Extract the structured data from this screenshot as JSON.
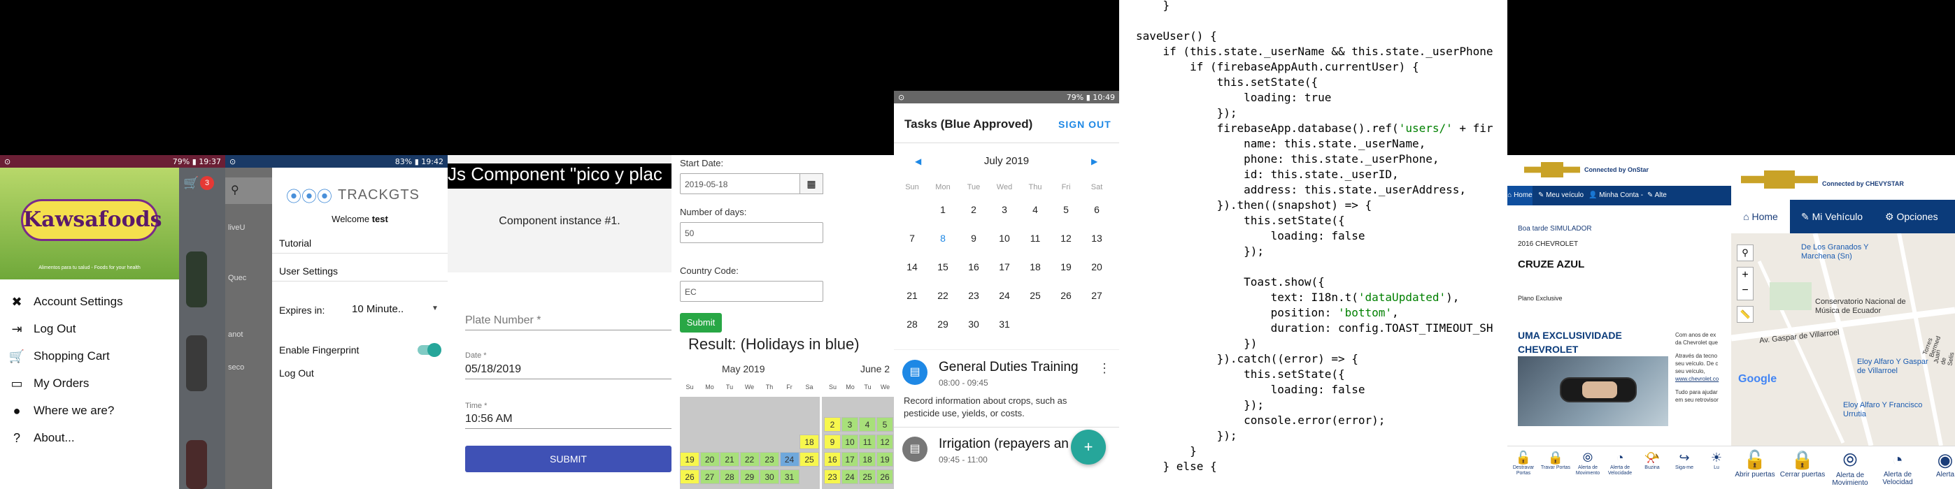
{
  "kawsa": {
    "time": "79% ▮ 19:37",
    "logo_text": "Kawsafoods",
    "logo_tagline": "Alimentos para tu salud - Foods for your health",
    "cart_count": "3",
    "menu": [
      {
        "icon": "✖",
        "label": "Account Settings"
      },
      {
        "icon": "⇥",
        "label": "Log Out"
      },
      {
        "icon": "🛒",
        "label": "Shopping Cart"
      },
      {
        "icon": "▭",
        "label": "My Orders"
      },
      {
        "icon": "●",
        "label": "Where we are?"
      },
      {
        "icon": "?",
        "label": "About..."
      }
    ]
  },
  "trackgts": {
    "time": "83% ▮ 19:42",
    "brand": "TRACKGTS",
    "welcome_prefix": "Welcome ",
    "welcome_user": "test",
    "tutorial": "Tutorial",
    "user_settings": "User Settings",
    "expires_label": "Expires in:",
    "expires_value": "10 Minute..",
    "fingerprint_label": "Enable Fingerprint",
    "logout": "Log Out",
    "bg_items": [
      "liveU",
      "Quec",
      "anot",
      "seco"
    ]
  },
  "vue": {
    "title": "Js Component \"pico y plac",
    "instance": "Component instance #1.",
    "plate_placeholder": "Plate Number *",
    "date_label": "Date *",
    "date_value": "05/18/2019",
    "time_label": "Time *",
    "time_value": "10:56 AM",
    "submit": "SUBMIT"
  },
  "holidays": {
    "start_label": "Start Date:",
    "start_value": "2019-05-18",
    "days_label": "Number of days:",
    "days_value": "50",
    "country_label": "Country Code:",
    "country_value": "EC",
    "submit": "Submit",
    "result": "Result: (Holidays in blue)",
    "month1": "May 2019",
    "month2": "June 2",
    "weekdays": [
      "Su",
      "Mo",
      "Tu",
      "We",
      "Th",
      "Fr",
      "Sa"
    ],
    "may_rows": [
      [
        "",
        "",
        "",
        "",
        "",
        "",
        ""
      ],
      [
        "",
        "",
        "",
        "",
        "",
        "",
        ""
      ],
      [
        "",
        "",
        "",
        "",
        "",
        "",
        "18"
      ],
      [
        "19",
        "20",
        "21",
        "22",
        "23",
        "24",
        "25"
      ],
      [
        "26",
        "27",
        "28",
        "29",
        "30",
        "31",
        ""
      ]
    ],
    "june_rows": [
      [
        "2",
        "3",
        "4",
        "5"
      ],
      [
        "9",
        "10",
        "11",
        "12"
      ],
      [
        "16",
        "17",
        "18",
        "19"
      ],
      [
        "23",
        "24",
        "25",
        "26"
      ]
    ]
  },
  "tasks": {
    "time": "79% ▮ 10:49",
    "title": "Tasks (Blue Approved)",
    "sign_out": "SIGN OUT",
    "month": "July 2019",
    "weekdays": [
      "Sun",
      "Mon",
      "Tue",
      "Wed",
      "Thu",
      "Fri",
      "Sat"
    ],
    "weeks": [
      [
        "",
        "1",
        "2",
        "3",
        "4",
        "5",
        "6"
      ],
      [
        "7",
        "8",
        "9",
        "10",
        "11",
        "12",
        "13"
      ],
      [
        "14",
        "15",
        "16",
        "17",
        "18",
        "19",
        "20"
      ],
      [
        "21",
        "22",
        "23",
        "24",
        "25",
        "26",
        "27"
      ],
      [
        "28",
        "29",
        "30",
        "31",
        "",
        "",
        ""
      ]
    ],
    "task1_title": "General Duties Training",
    "task1_time": "08:00 - 09:45",
    "task1_desc": "Record information about crops, such as pesticide use, yields, or costs.",
    "task2_title": "Irrigation (repayers an",
    "task2_time": "09:45 - 11:00",
    "fab": "+"
  },
  "code": {
    "lines": [
      "    }",
      "",
      "saveUser() {",
      "    if (this.state._userName && this.state._userPhone",
      "        if (firebaseAppAuth.currentUser) {",
      "            this.setState({",
      "                loading: true",
      "            });",
      "            firebaseApp.database().ref('users/' + fir",
      "                name: this.state._userName,",
      "                phone: this.state._userPhone,",
      "                id: this.state._userID,",
      "                address: this.state._userAddress,",
      "            }).then((snapshot) => {",
      "                this.setState({",
      "                    loading: false",
      "                });",
      "",
      "                Toast.show({",
      "                    text: I18n.t('dataUpdated'),",
      "                    position: 'bottom',",
      "                    duration: config.TOAST_TIMEOUT_SH",
      "                })",
      "            }).catch((error) => {",
      "                this.setState({",
      "                    loading: false",
      "                });",
      "                console.error(error);",
      "            });",
      "        }",
      "    } else {"
    ]
  },
  "onstar": {
    "connected": "Connected by OnStar",
    "nav": [
      "Home",
      "Meu veículo",
      "Minha Conta -",
      "Alte"
    ],
    "greeting": "Boa tarde SIMULADOR",
    "year_model": "2016 CHEVROLET",
    "model": "CRUZE AZUL",
    "plan": "Plano Exclusive",
    "promo_title_1": "UMA EXCLUSIVIDADE",
    "promo_title_2": "CHEVROLET",
    "promo_side": "Com anos de ex",
    "promo_side2": "da Chevrolet que",
    "promo_side3": "Através da tecno",
    "promo_side4": "seu veículo. De c",
    "promo_side5": "seu veículo,",
    "promo_link": "www.chevrolet.co",
    "promo_side6": "Tudo para ajudar",
    "promo_side7": "em seu retrovisor",
    "bottom": [
      "Destravar Portas",
      "Travar Portas",
      "Alerta de Movimento",
      "Alerta de Velocidade",
      "Buzina",
      "Siga-me",
      "Lu"
    ]
  },
  "map": {
    "connected": "Connected by CHEVYSTAR",
    "nav_home": "Home",
    "nav_vehicle": "Mi Vehículo",
    "nav_options": "Opciones",
    "places": [
      "De Los Granados Y Marchena (Sn)",
      "Conservatorio Nacional de Música de Ecuador",
      "Av. Gaspar de Villarroel",
      "Eloy Alfaro Y Gaspar de Villarroel",
      "Eloy Alfaro Y Francisco Urrutia",
      "Torres Bermed",
      "Juan de Selis"
    ],
    "google": "Google",
    "bottom": [
      "Abrir puertas",
      "Cerrar puertas",
      "Alerta de Movimiento",
      "Alerta de Velocidad",
      "Alerta"
    ]
  }
}
